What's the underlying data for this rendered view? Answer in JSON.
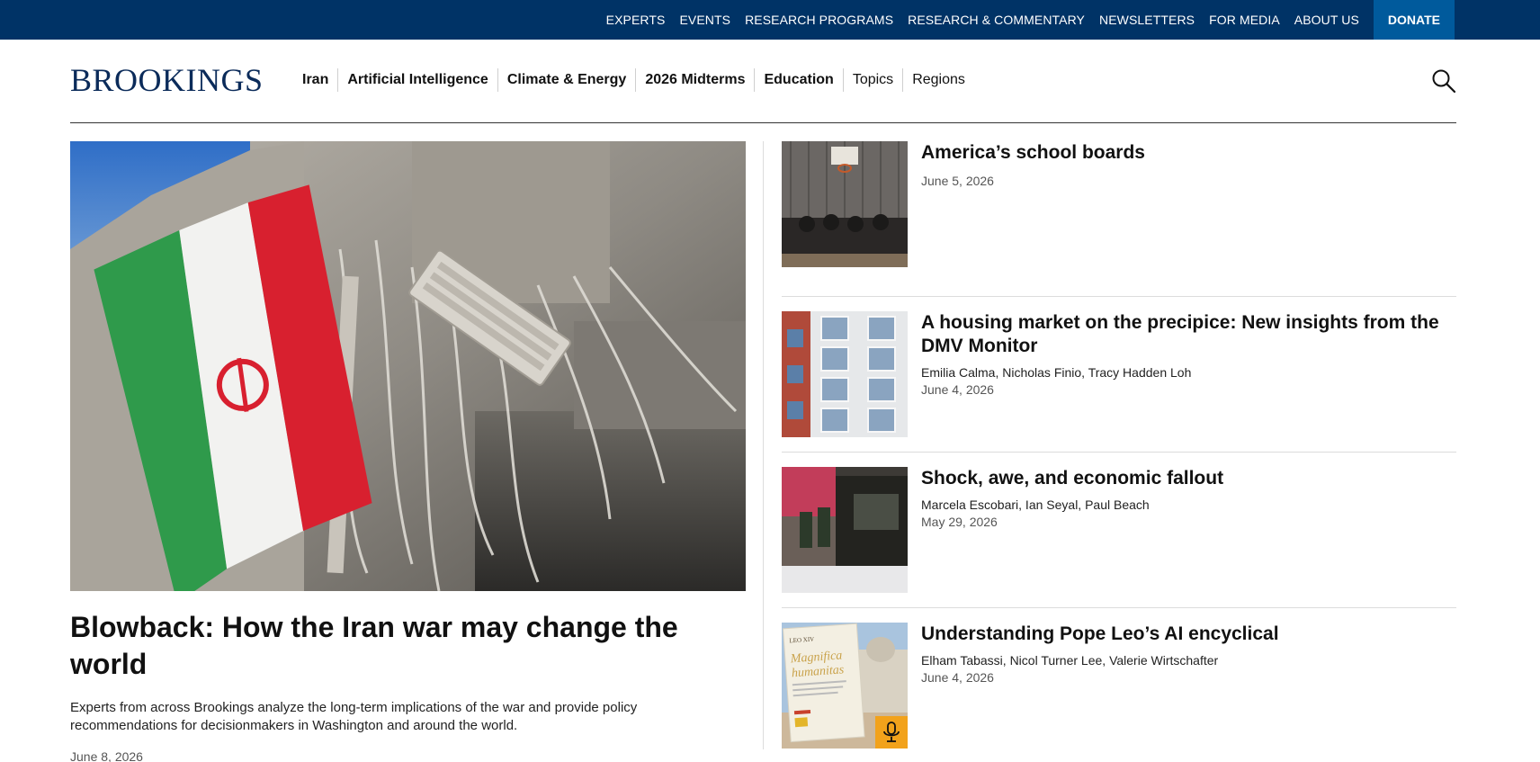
{
  "utility_nav": {
    "links": [
      "EXPERTS",
      "EVENTS",
      "RESEARCH PROGRAMS",
      "RESEARCH & COMMENTARY",
      "NEWSLETTERS",
      "FOR MEDIA",
      "ABOUT US"
    ],
    "donate": "DONATE"
  },
  "header": {
    "logo": "BROOKINGS",
    "nav": [
      "Iran",
      "Artificial Intelligence",
      "Climate & Energy",
      "2026 Midterms",
      "Education",
      "Topics",
      "Regions"
    ]
  },
  "feature": {
    "title": "Blowback: How the Iran war may change the world",
    "description": "Experts from across Brookings analyze the long-term implications of the war and provide policy recommendations for decisionmakers in Washington and around the world.",
    "date": "June 8, 2026"
  },
  "stories": [
    {
      "title": "America’s school boards",
      "authors": "",
      "date": "June 5, 2026"
    },
    {
      "title": "A housing market on the precipice: New insights from the DMV Monitor",
      "authors": "Emilia Calma, Nicholas Finio, Tracy Hadden Loh",
      "date": "June 4, 2026"
    },
    {
      "title": "Shock, awe, and economic fallout",
      "authors": "Marcela Escobari, Ian Seyal, Paul Beach",
      "date": "May 29, 2026"
    },
    {
      "title": "Understanding Pope Leo’s AI encyclical",
      "authors": "Elham Tabassi, Nicol Turner Lee, Valerie Wirtschafter",
      "date": "June 4, 2026"
    }
  ],
  "podcast_book": {
    "line1": "LEO XIV",
    "line2": "Magnifica",
    "line3": "humanitas"
  },
  "colors": {
    "utility_bar": "#003366",
    "donate": "#005a9c",
    "logo": "#0b2b5a",
    "podcast_badge": "#f2a21b"
  }
}
